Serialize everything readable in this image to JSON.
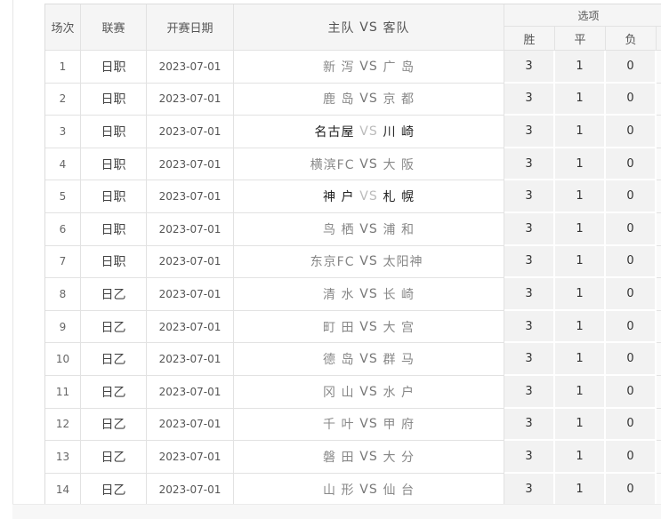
{
  "header": {
    "col_index": "场次",
    "col_league": "联赛",
    "col_date": "开赛日期",
    "col_home": "主队",
    "col_vs": "VS",
    "col_away": "客队",
    "options": "选项",
    "opt_win": "胜",
    "opt_draw": "平",
    "opt_loss": "负"
  },
  "rows": [
    {
      "no": "1",
      "league": "日职",
      "date": "2023-07-01",
      "home": "新 泻",
      "vs": "VS",
      "away": "广 岛",
      "win": "3",
      "draw": "1",
      "loss": "0",
      "dark": false
    },
    {
      "no": "2",
      "league": "日职",
      "date": "2023-07-01",
      "home": "鹿 岛",
      "vs": "VS",
      "away": "京 都",
      "win": "3",
      "draw": "1",
      "loss": "0",
      "dark": false
    },
    {
      "no": "3",
      "league": "日职",
      "date": "2023-07-01",
      "home": "名古屋",
      "vs": "VS",
      "away": "川 崎",
      "win": "3",
      "draw": "1",
      "loss": "0",
      "dark": true
    },
    {
      "no": "4",
      "league": "日职",
      "date": "2023-07-01",
      "home": "横滨FC",
      "vs": "VS",
      "away": "大 阪",
      "win": "3",
      "draw": "1",
      "loss": "0",
      "dark": false
    },
    {
      "no": "5",
      "league": "日职",
      "date": "2023-07-01",
      "home": "神 户",
      "vs": "VS",
      "away": "札 幌",
      "win": "3",
      "draw": "1",
      "loss": "0",
      "dark": true
    },
    {
      "no": "6",
      "league": "日职",
      "date": "2023-07-01",
      "home": "鸟 栖",
      "vs": "VS",
      "away": "浦 和",
      "win": "3",
      "draw": "1",
      "loss": "0",
      "dark": false
    },
    {
      "no": "7",
      "league": "日职",
      "date": "2023-07-01",
      "home": "东京FC",
      "vs": "VS",
      "away": "太阳神",
      "win": "3",
      "draw": "1",
      "loss": "0",
      "dark": false
    },
    {
      "no": "8",
      "league": "日乙",
      "date": "2023-07-01",
      "home": "清 水",
      "vs": "VS",
      "away": "长 崎",
      "win": "3",
      "draw": "1",
      "loss": "0",
      "dark": false
    },
    {
      "no": "9",
      "league": "日乙",
      "date": "2023-07-01",
      "home": "町 田",
      "vs": "VS",
      "away": "大 宫",
      "win": "3",
      "draw": "1",
      "loss": "0",
      "dark": false
    },
    {
      "no": "10",
      "league": "日乙",
      "date": "2023-07-01",
      "home": "德 岛",
      "vs": "VS",
      "away": "群 马",
      "win": "3",
      "draw": "1",
      "loss": "0",
      "dark": false
    },
    {
      "no": "11",
      "league": "日乙",
      "date": "2023-07-01",
      "home": "冈 山",
      "vs": "VS",
      "away": "水 户",
      "win": "3",
      "draw": "1",
      "loss": "0",
      "dark": false
    },
    {
      "no": "12",
      "league": "日乙",
      "date": "2023-07-01",
      "home": "千 叶",
      "vs": "VS",
      "away": "甲 府",
      "win": "3",
      "draw": "1",
      "loss": "0",
      "dark": false
    },
    {
      "no": "13",
      "league": "日乙",
      "date": "2023-07-01",
      "home": "磐 田",
      "vs": "VS",
      "away": "大 分",
      "win": "3",
      "draw": "1",
      "loss": "0",
      "dark": false
    },
    {
      "no": "14",
      "league": "日乙",
      "date": "2023-07-01",
      "home": "山 形",
      "vs": "VS",
      "away": "仙 台",
      "win": "3",
      "draw": "1",
      "loss": "0",
      "dark": false
    }
  ]
}
